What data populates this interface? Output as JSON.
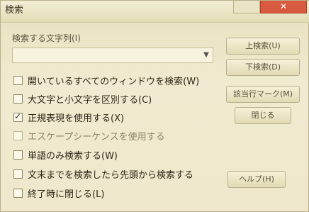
{
  "window": {
    "title": "検索"
  },
  "titlebar": {
    "minimize_glyph": "",
    "close_glyph": "✕"
  },
  "search": {
    "label": "検索する文字列(I)",
    "value": ""
  },
  "buttons": {
    "find_up": "上検索(U)",
    "find_down": "下検索(D)",
    "mark_all": "該当行マーク(M)",
    "close": "閉じる",
    "help": "ヘルプ(H)"
  },
  "options": [
    {
      "label": "開いているすべてのウィンドウを検索(W)",
      "checked": false,
      "enabled": true
    },
    {
      "label": "大文字と小文字を区別する(C)",
      "checked": false,
      "enabled": true
    },
    {
      "label": "正規表現を使用する(X)",
      "checked": true,
      "enabled": true
    },
    {
      "label": "エスケープシーケンスを使用する",
      "checked": false,
      "enabled": false
    },
    {
      "label": "単語のみ検索する(W)",
      "checked": false,
      "enabled": true
    },
    {
      "label": "文末までを検索したら先頭から検索する",
      "checked": false,
      "enabled": true
    },
    {
      "label": "終了時に閉じる(L)",
      "checked": false,
      "enabled": true
    }
  ]
}
